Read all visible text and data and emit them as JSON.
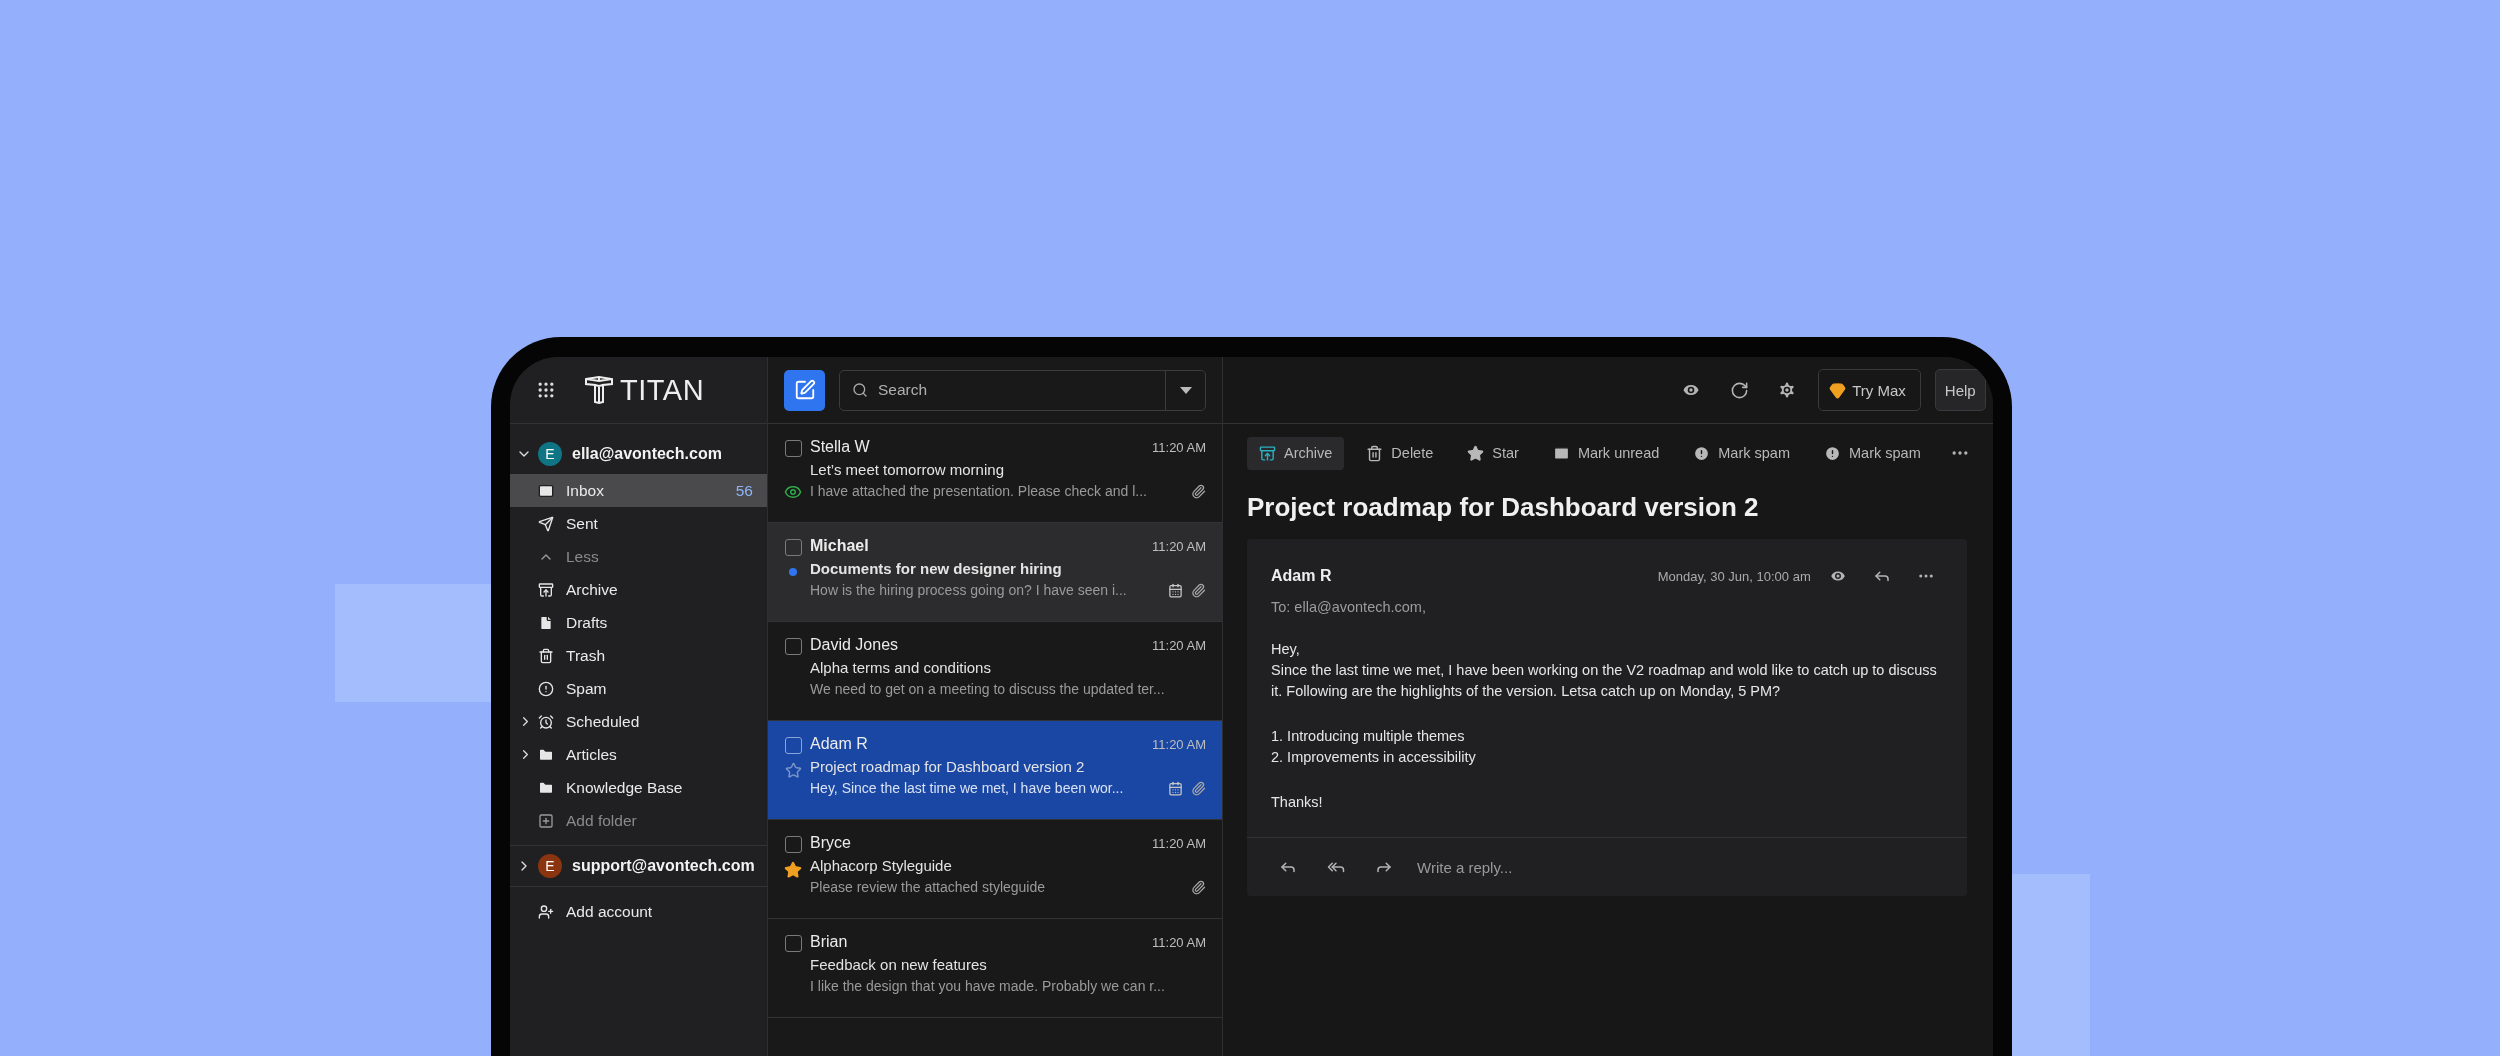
{
  "app": {
    "logo": "TITAN"
  },
  "accounts": [
    {
      "email": "ella@avontech.com",
      "initial": "E",
      "color": "#0f7484",
      "expanded": true,
      "folders": [
        {
          "label": "Inbox",
          "kind": "folder",
          "selected": true,
          "count": "56"
        },
        {
          "label": "Sent",
          "kind": "folder",
          "selected": false
        },
        {
          "label": "Less",
          "kind": "action",
          "selected": false
        },
        {
          "label": "Archive",
          "kind": "folder",
          "selected": false
        },
        {
          "label": "Drafts",
          "kind": "folder",
          "selected": false
        },
        {
          "label": "Trash",
          "kind": "folder",
          "selected": false
        },
        {
          "label": "Spam",
          "kind": "folder",
          "selected": false
        },
        {
          "label": "Scheduled",
          "kind": "group",
          "selected": false,
          "expanded": false
        },
        {
          "label": "Articles",
          "kind": "group",
          "selected": false,
          "expanded": false
        },
        {
          "label": "Knowledge Base",
          "kind": "folder",
          "selected": false
        },
        {
          "label": "Add folder",
          "kind": "action",
          "selected": false
        }
      ]
    },
    {
      "email": "support@avontech.com",
      "initial": "E",
      "color": "#8a3410",
      "expanded": false
    }
  ],
  "add_account": "Add account",
  "search": {
    "placeholder": "Search"
  },
  "top_actions": {
    "try_max": "Try Max",
    "help": "Help"
  },
  "mails": [
    {
      "sender": "Stella W",
      "time": "11:20 AM",
      "subject": "Let’s meet tomorrow morning",
      "preview": "I have attached the presentation. Please check and l...",
      "checked": false,
      "selected": false,
      "highlighted": false,
      "unread": false,
      "starred": false,
      "seen": true,
      "has_event": false,
      "has_attachment": true
    },
    {
      "sender": "Michael",
      "time": "11:20 AM",
      "subject": "Documents for new designer hiring",
      "preview": "How is the hiring process going on? I have seen i...",
      "checked": false,
      "selected": false,
      "highlighted": true,
      "unread": true,
      "starred": false,
      "seen": false,
      "has_event": true,
      "has_attachment": true
    },
    {
      "sender": "David Jones",
      "time": "11:20 AM",
      "subject": "Alpha terms and conditions",
      "preview": "We need to get on a meeting to discuss the updated ter...",
      "checked": false,
      "selected": false,
      "highlighted": false,
      "unread": false,
      "starred": false,
      "seen": false,
      "has_event": false,
      "has_attachment": false
    },
    {
      "sender": "Adam R",
      "time": "11:20 AM",
      "subject": "Project roadmap for Dashboard version 2",
      "preview": "Hey, Since the last time we met, I have been wor...",
      "checked": false,
      "selected": true,
      "highlighted": false,
      "unread": false,
      "starred": false,
      "seen": false,
      "has_event": true,
      "has_attachment": true
    },
    {
      "sender": "Bryce",
      "time": "11:20 AM",
      "subject": "Alphacorp Styleguide",
      "preview": "Please review the attached styleguide",
      "checked": false,
      "selected": false,
      "highlighted": false,
      "unread": false,
      "starred": true,
      "seen": false,
      "has_event": false,
      "has_attachment": true
    },
    {
      "sender": "Brian",
      "time": "11:20 AM",
      "subject": "Feedback on new features",
      "preview": "I like the design that you have made. Probably we can r...",
      "checked": false,
      "selected": false,
      "highlighted": false,
      "unread": false,
      "starred": false,
      "seen": false,
      "has_event": false,
      "has_attachment": false
    }
  ],
  "toolbar": [
    {
      "label": "Archive",
      "selected": true
    },
    {
      "label": "Delete",
      "selected": false
    },
    {
      "label": "Star",
      "selected": false
    },
    {
      "label": "Mark unread",
      "selected": false
    },
    {
      "label": "Mark spam",
      "selected": false
    },
    {
      "label": "Mark spam",
      "selected": false
    }
  ],
  "message": {
    "title": "Project roadmap for Dashboard version 2",
    "sender": "Adam R",
    "date": "Monday, 30 Jun, 10:00 am",
    "to": "To: ella@avontech.com,",
    "paragraphs": [
      [
        "Hey,",
        "Since the last time we met, I have been working on the V2 roadmap and wold like to catch up to discuss it. Following are the highlights of the version. Letsa catch up on Monday, 5 PM?"
      ],
      [
        "1. Introducing multiple themes",
        "2. Improvements in accessibility"
      ],
      [
        "Thanks!"
      ]
    ],
    "reply_placeholder": "Write a reply..."
  }
}
